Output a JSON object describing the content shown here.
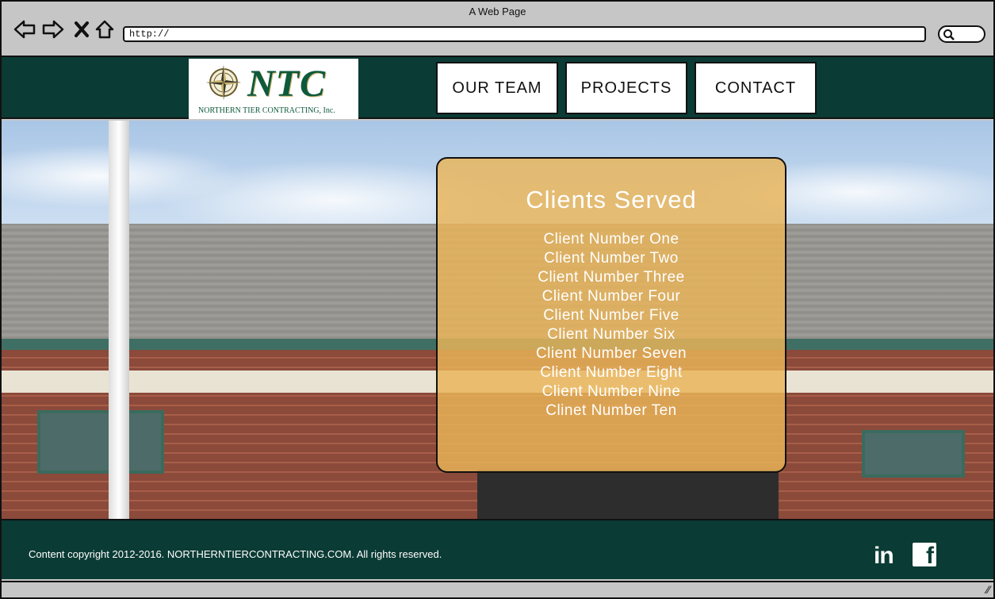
{
  "window": {
    "title": "A Web Page"
  },
  "browser": {
    "url": "http://"
  },
  "brand": {
    "logo_main": "NTC",
    "logo_sub": "NORTHERN TIER CONTRACTING, Inc."
  },
  "nav": {
    "items": [
      {
        "label": "OUR TEAM"
      },
      {
        "label": "PROJECTS"
      },
      {
        "label": "CONTACT"
      }
    ]
  },
  "clients": {
    "title": "Clients Served",
    "items": [
      "Client Number One",
      "Client Number Two",
      "Client Number Three",
      "Client Number Four",
      "Client Number Five",
      "Client Number Six",
      "Client Number Seven",
      "Client Number Eight",
      "Client Number Nine",
      "Clinet Number Ten"
    ]
  },
  "footer": {
    "copyright": "Content copyright 2012-2016. NORTHERNTIERCONTRACTING.COM. All rights reserved.",
    "linkedin_label": "in",
    "facebook_label": "f"
  },
  "colors": {
    "brand_dark": "#0b3b35",
    "panel": "#eab458"
  }
}
